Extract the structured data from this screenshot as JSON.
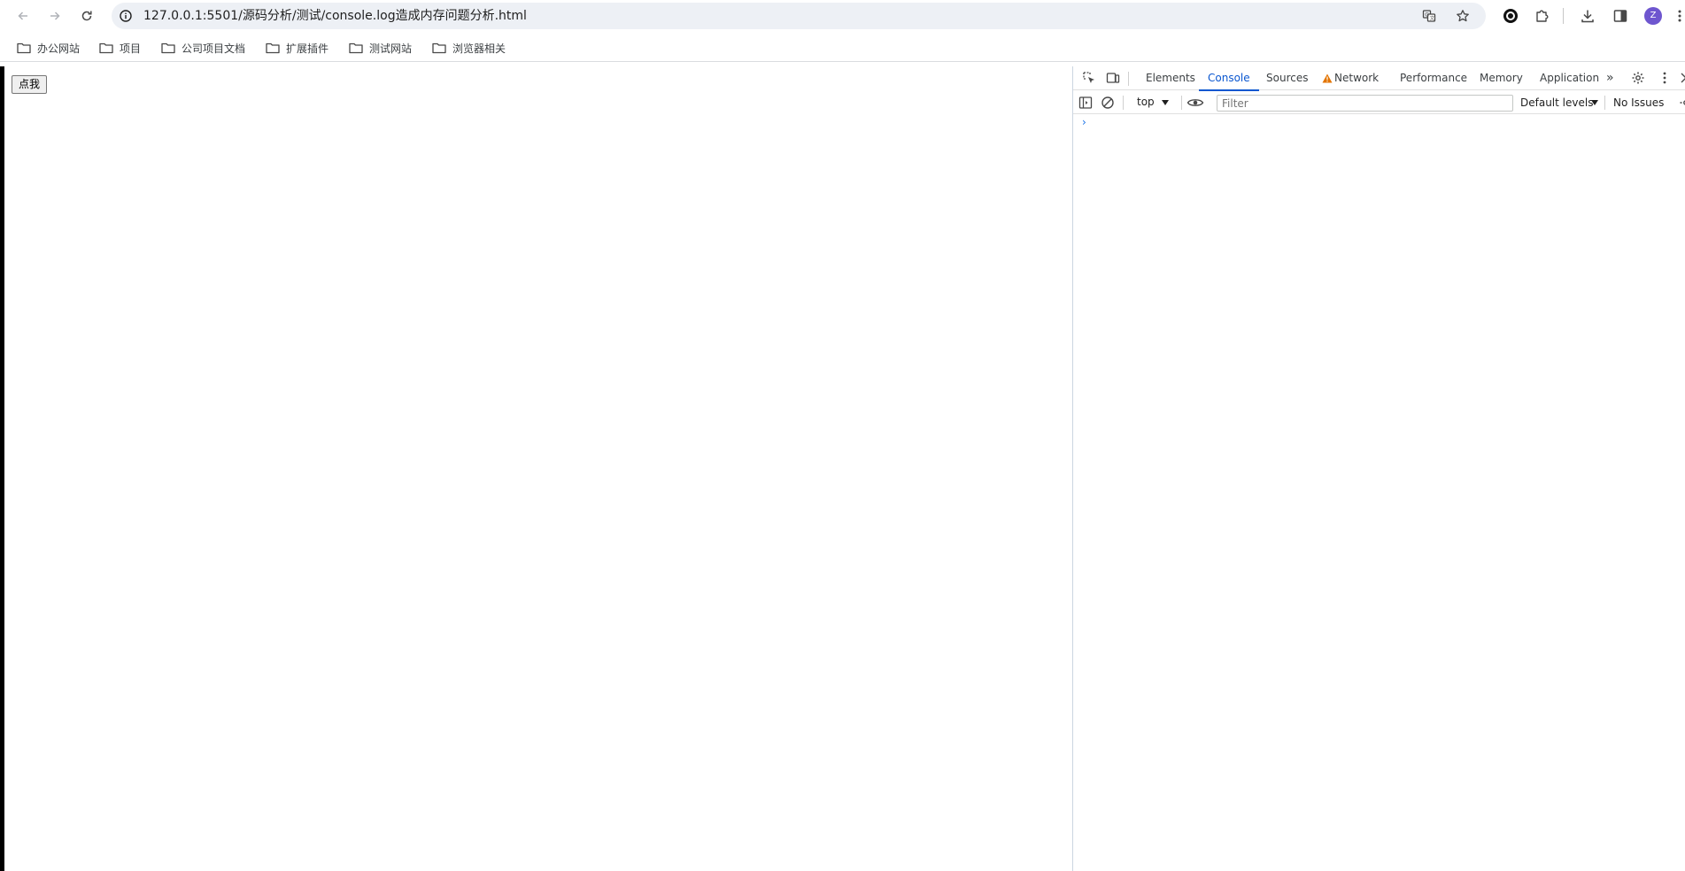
{
  "browser": {
    "url": "127.0.0.1:5501/源码分析/测试/console.log造成内存问题分析.html",
    "profile_initial": "Z",
    "icons": {
      "back": "back-arrow-icon",
      "forward": "forward-arrow-icon",
      "reload": "reload-icon",
      "site_info": "info-icon",
      "translate": "translate-icon",
      "bookmark": "star-icon",
      "extension1": "record-icon",
      "extensions": "puzzle-icon",
      "downloads": "download-icon",
      "side_panel": "side-panel-icon",
      "menu": "kebab-menu-icon"
    }
  },
  "bookmarks": [
    {
      "label": "办公网站"
    },
    {
      "label": "项目"
    },
    {
      "label": "公司项目文档"
    },
    {
      "label": "扩展插件"
    },
    {
      "label": "测试网站"
    },
    {
      "label": "浏览器相关"
    }
  ],
  "page": {
    "button_label": "点我"
  },
  "devtools": {
    "tabs": [
      {
        "label": "Elements"
      },
      {
        "label": "Console"
      },
      {
        "label": "Sources"
      },
      {
        "label": "Network"
      },
      {
        "label": "Performance"
      },
      {
        "label": "Memory"
      },
      {
        "label": "Application"
      }
    ],
    "active_tab": "Console",
    "more_tabs": "»",
    "console": {
      "context": "top",
      "filter_placeholder": "Filter",
      "levels": "Default levels",
      "issues": "No Issues",
      "prompt": "›"
    },
    "colors": {
      "accent": "#0b57d0",
      "warning": "#e37400"
    }
  }
}
